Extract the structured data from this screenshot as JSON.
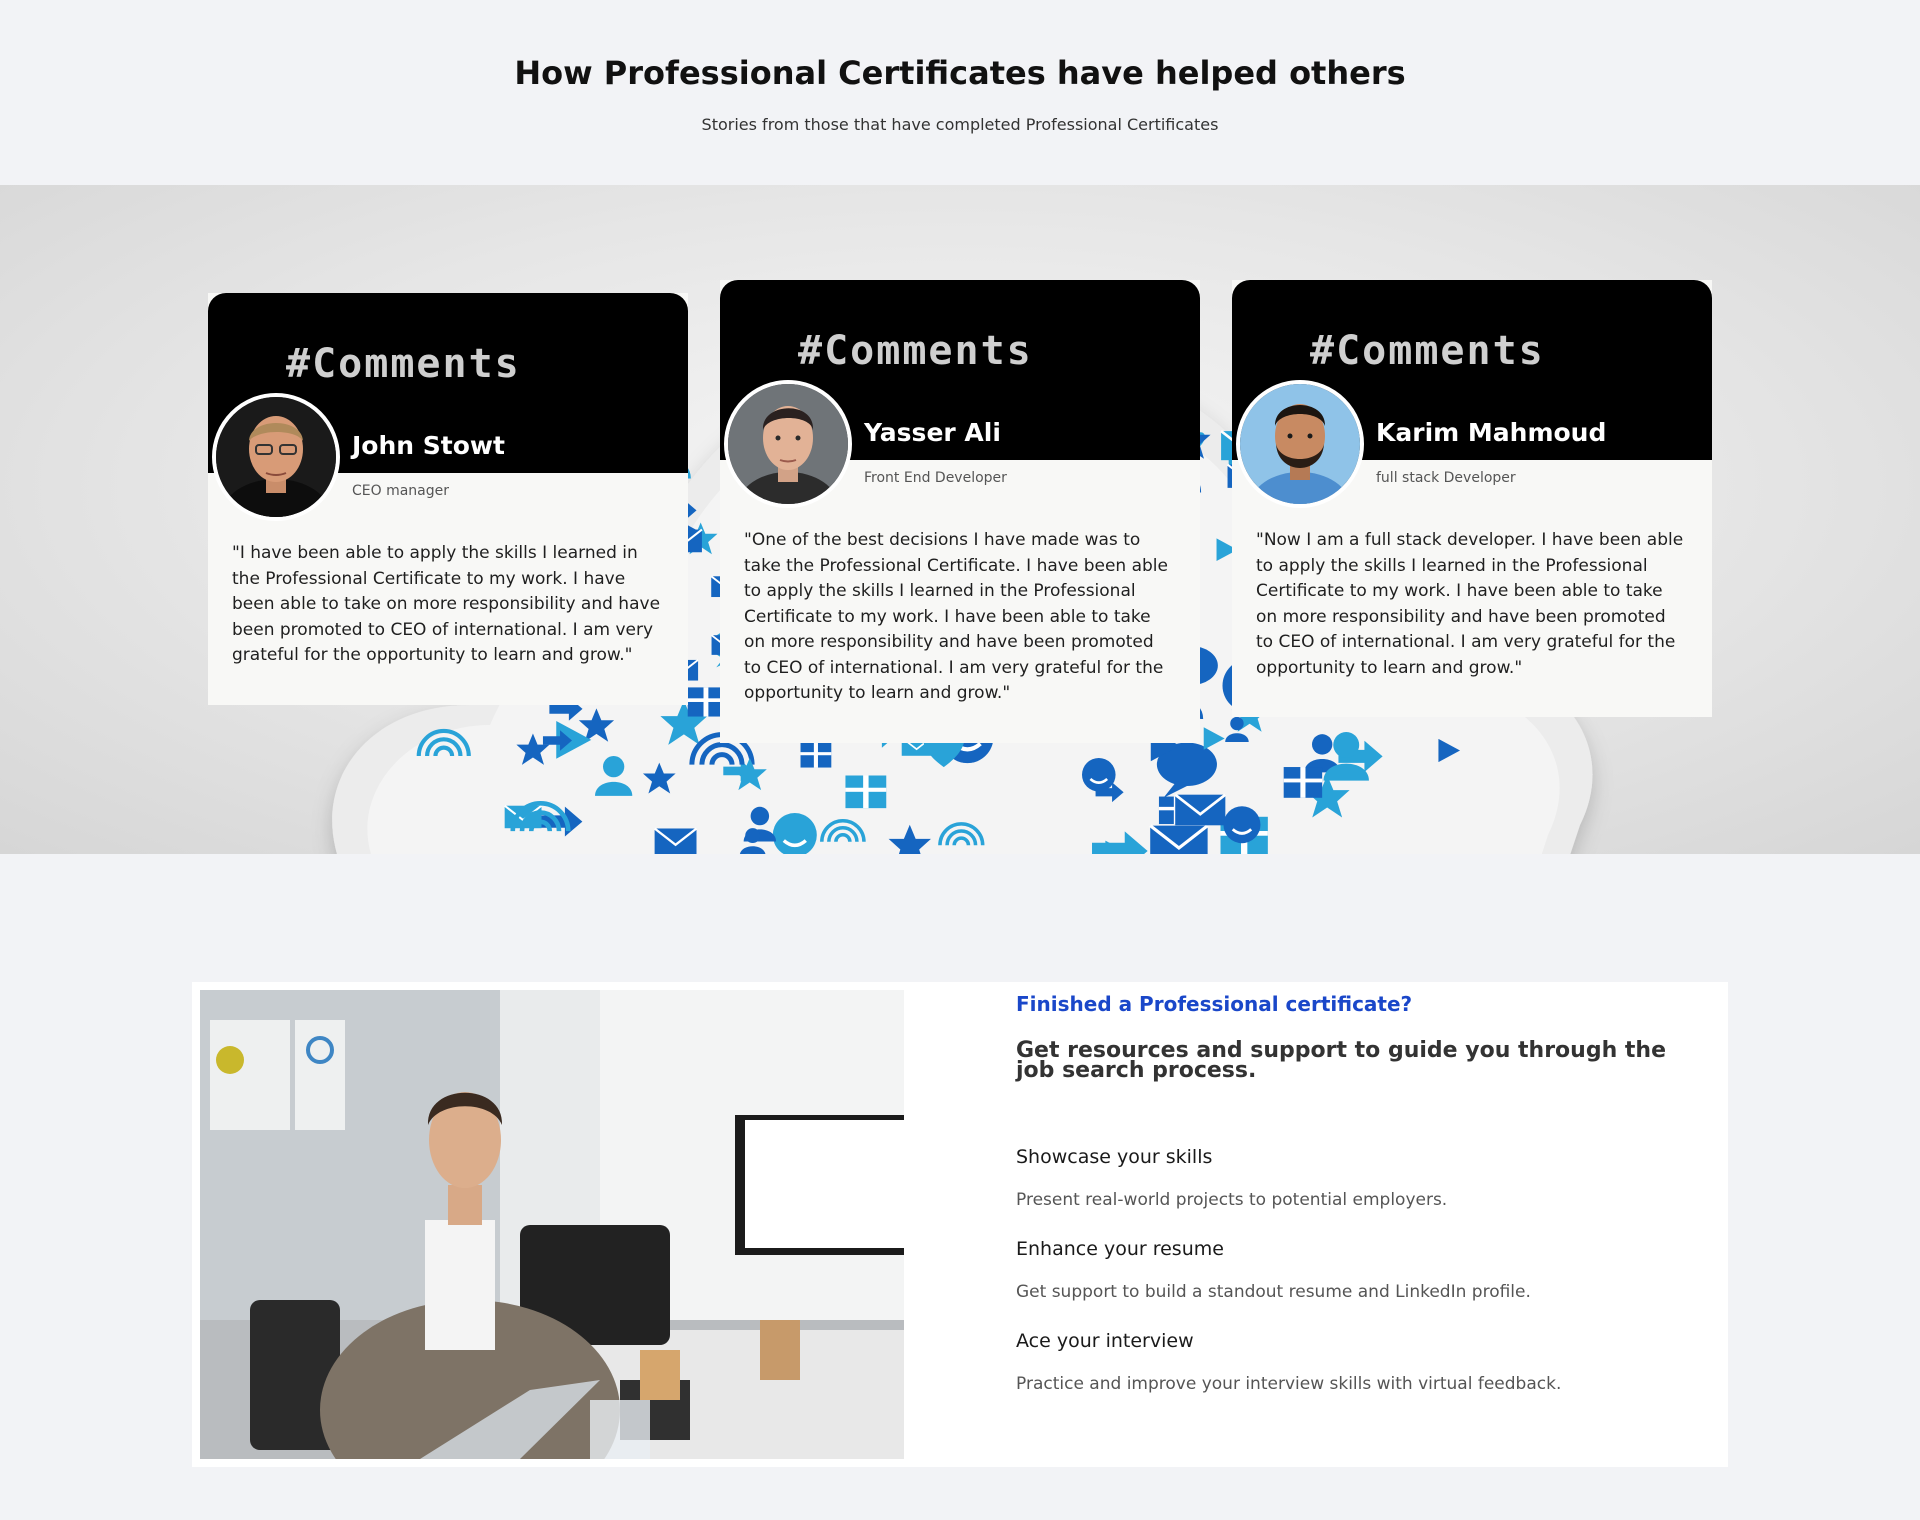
{
  "header": {
    "title": "How Professional Certificates have helped others",
    "subtitle": "Stories from those that have completed Professional Certificates"
  },
  "testimonials": [
    {
      "tag": "#Comments",
      "name": "John Stowt",
      "role": "CEO manager",
      "quote": "\"I have been able to apply the skills I learned in the Professional Certificate to my work. I have been able to take on more responsibility and have been promoted to CEO of international. I am very grateful for the opportunity to learn and grow.\""
    },
    {
      "tag": "#Comments",
      "name": "Yasser Ali",
      "role": "Front End Developer",
      "quote": "\"One of the best decisions I have made was to take the Professional Certificate. I have been able to apply the skills I learned in the Professional Certificate to my work. I have been able to take on more responsibility and have been promoted to CEO of international. I am very grateful for the opportunity to learn and grow.\""
    },
    {
      "tag": "#Comments",
      "name": "Karim Mahmoud",
      "role": "full stack Developer",
      "quote": "\"Now I am a full stack developer. I have been able to apply the skills I learned in the Professional Certificate to my work. I have been able to take on more responsibility and have been promoted to CEO of international. I am very grateful for the opportunity to learn and grow.\""
    }
  ],
  "resources": {
    "kicker": "Finished a Professional certificate?",
    "heading": "Get resources and support to guide you through the job search process.",
    "features": [
      {
        "title": "Showcase your skills",
        "desc": "Present real-world projects to potential employers."
      },
      {
        "title": "Enhance your resume",
        "desc": "Get support to build a standout resume and LinkedIn profile."
      },
      {
        "title": "Ace your interview",
        "desc": "Practice and improve your interview skills with virtual feedback."
      }
    ]
  },
  "colors": {
    "page_bg": "#f2f3f6",
    "card_header": "#000000",
    "accent_blue": "#1a47c9",
    "icon_blue_dark": "#1565c0",
    "icon_blue_light": "#29a3d8"
  },
  "icons": [
    "speech-bubble-icon",
    "star-icon",
    "heart-icon",
    "envelope-icon",
    "gift-icon",
    "person-icon",
    "arrow-icon",
    "smiley-icon",
    "wifi-icon",
    "play-icon"
  ]
}
